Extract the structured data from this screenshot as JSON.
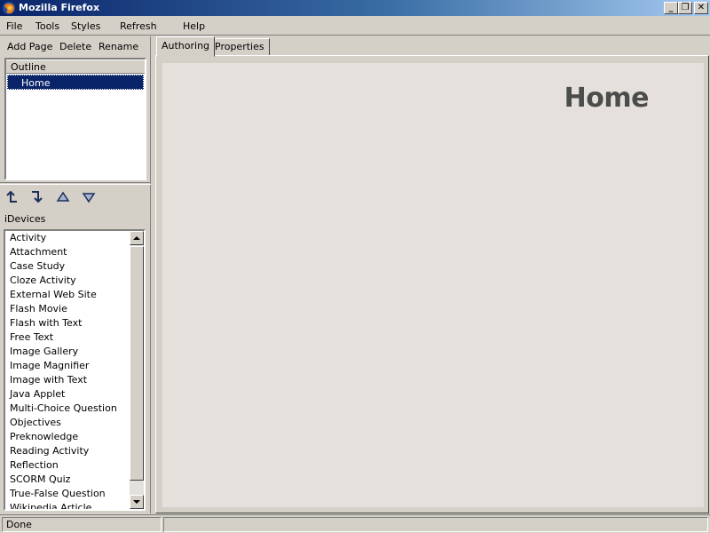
{
  "window": {
    "title": "Mozilla Firefox",
    "minimize": "_",
    "restore": "❐",
    "close": "✕"
  },
  "menu": [
    "File",
    "Tools",
    "Styles",
    "Refresh",
    "Help"
  ],
  "toolbar": {
    "add_page": "Add Page",
    "delete": "Delete",
    "rename": "Rename"
  },
  "outline": {
    "header": "Outline",
    "items": [
      "Home"
    ]
  },
  "arrows": [
    "promote-icon",
    "demote-icon",
    "move-up-icon",
    "move-down-icon"
  ],
  "idevices": {
    "label": "iDevices",
    "items": [
      "Activity",
      "Attachment",
      "Case Study",
      "Cloze Activity",
      "External Web Site",
      "Flash Movie",
      "Flash with Text",
      "Free Text",
      "Image Gallery",
      "Image Magnifier",
      "Image with Text",
      "Java Applet",
      "Multi-Choice Question",
      "Objectives",
      "Preknowledge",
      "Reading Activity",
      "Reflection",
      "SCORM Quiz",
      "True-False Question",
      "Wikipedia Article"
    ]
  },
  "tabs": [
    "Authoring",
    "Properties"
  ],
  "content": {
    "heading": "Home"
  },
  "status": {
    "text": "Done"
  },
  "colors": {
    "titlebar_start": "#0a246a",
    "selection": "#0a246a",
    "content_bg": "#e6e0dc"
  }
}
